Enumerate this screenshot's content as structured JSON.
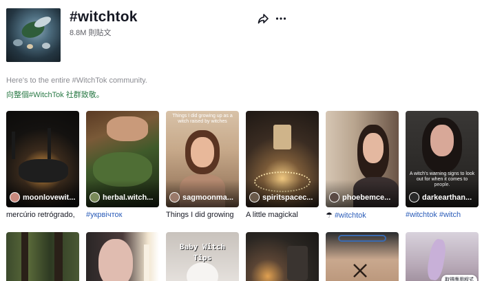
{
  "header": {
    "title": "#witchtok",
    "post_count": "8.8M 則貼文",
    "share_icon": "share-icon",
    "more_icon": "more-icon"
  },
  "description": {
    "english": "Here's to the entire #WitchTok community.",
    "chinese": "向整個#WitchTok 社群致敬。"
  },
  "videos": [
    {
      "username": "moonlovewit...",
      "caption": "mercúrio retrógrado,",
      "overlay": ""
    },
    {
      "username": "herbal.witch...",
      "caption": "#укрвічток",
      "overlay": ""
    },
    {
      "username": "sagmoonma...",
      "caption": "Things I did growing",
      "overlay": "Things I did growing up as a witch raised by witches"
    },
    {
      "username": "spiritspacec...",
      "caption": "A little magickal",
      "overlay": ""
    },
    {
      "username": "phoebemce...",
      "caption_prefix": "☂",
      "caption": "#witchtok",
      "overlay": ""
    },
    {
      "username": "darkearthan...",
      "caption": "#witchtok #witch",
      "overlay": "A witch's warning signs to look out for when it comes to people."
    }
  ],
  "row2": {
    "baby_witch_line1": "Baby Witch",
    "baby_witch_line2": "Tips",
    "get_app_label": "取得應用程式"
  }
}
